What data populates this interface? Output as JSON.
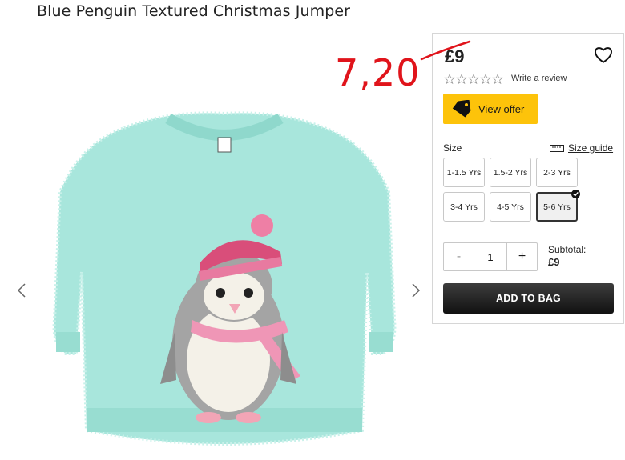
{
  "product": {
    "title": "Blue Penguin Textured Christmas Jumper"
  },
  "price": {
    "old": "£9",
    "handwritten_new": "7,20"
  },
  "reviews": {
    "star_count": 5,
    "write_review_label": "Write a review"
  },
  "offer": {
    "label": "View offer",
    "color": "#fdc30a"
  },
  "size": {
    "label": "Size",
    "guide_label": "Size guide",
    "options": [
      "1-1.5 Yrs",
      "1.5-2 Yrs",
      "2-3 Yrs",
      "3-4 Yrs",
      "4-5 Yrs",
      "5-6 Yrs"
    ],
    "selected": "5-6 Yrs"
  },
  "quantity": {
    "minus": "-",
    "value": "1",
    "plus": "+"
  },
  "subtotal": {
    "label": "Subtotal:",
    "value": "£9"
  },
  "add_to_bag": {
    "label": "ADD TO BAG"
  },
  "icons": [
    "chevron-left-icon",
    "chevron-right-icon",
    "heart-icon",
    "star-icon",
    "tag-icon",
    "ruler-icon",
    "checkmark-icon"
  ],
  "colors": {
    "jumper": "#a8e6dc",
    "annotation": "#e0141b",
    "button_dark": "#1a1a1a"
  }
}
